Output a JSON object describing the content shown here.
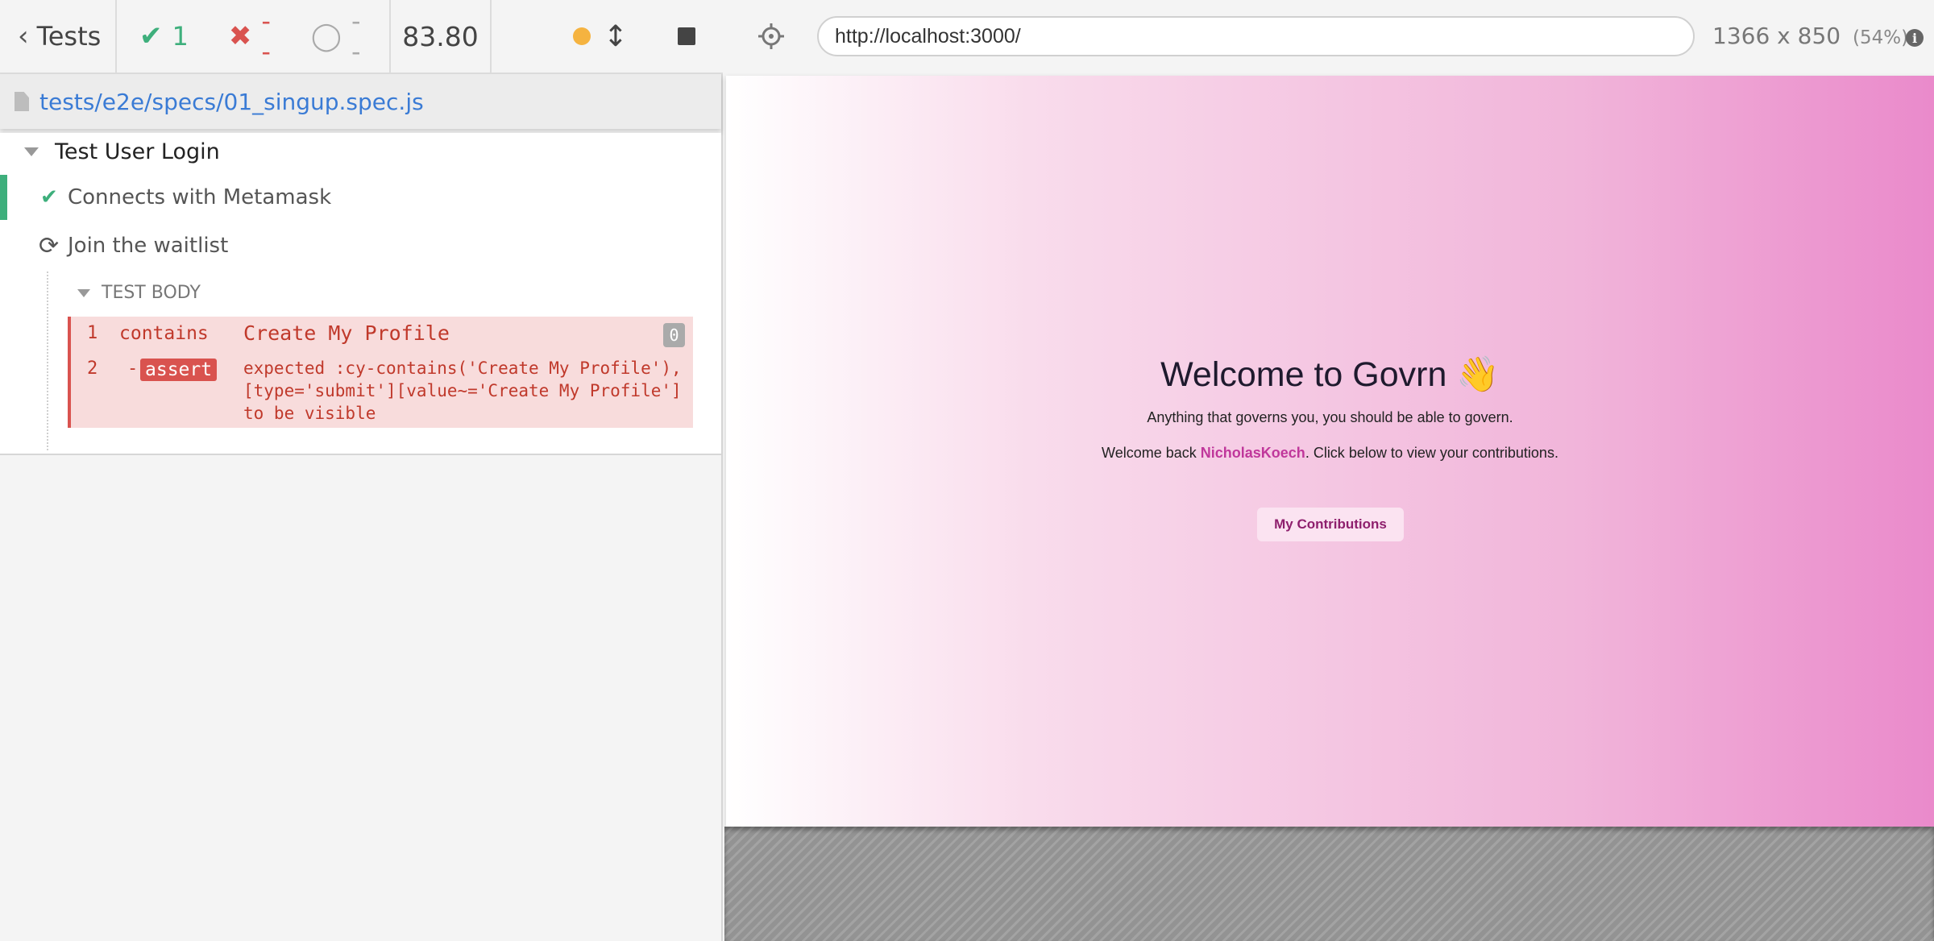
{
  "stats": {
    "tests_label": "Tests",
    "passed": "1",
    "failed": "--",
    "pending": "--",
    "duration": "83.80"
  },
  "spec": {
    "path": "tests/e2e/specs/01_singup.spec.js"
  },
  "suite": {
    "title": "Test User Login",
    "tests": [
      {
        "label": "Connects with Metamask",
        "state": "passed"
      },
      {
        "label": "Join the waitlist",
        "state": "running"
      }
    ],
    "body_title": "TEST BODY",
    "commands": [
      {
        "num": "1",
        "name": "contains",
        "message": "Create My Profile",
        "badge": "0"
      },
      {
        "num": "2",
        "name": "assert",
        "message": "expected :cy-contains('Create My Profile'),\n[type='submit'][value~='Create My Profile']\nto be visible"
      }
    ]
  },
  "browser": {
    "url": "http://localhost:3000/",
    "viewport": "1366 x 850",
    "scale": "(54%)"
  },
  "app": {
    "title": "Welcome to Govrn 👋",
    "subtitle": "Anything that governs you, you should be able to govern.",
    "welcome_prefix": "Welcome back ",
    "username": "NicholasKoech",
    "welcome_suffix": ". Click below to view your contributions.",
    "button_label": "My Contributions"
  },
  "colors": {
    "pass": "#3eaf7c",
    "fail": "#d9534f",
    "link": "#3a7bd5",
    "running": "#f5b340",
    "brand": "#c0379b"
  }
}
